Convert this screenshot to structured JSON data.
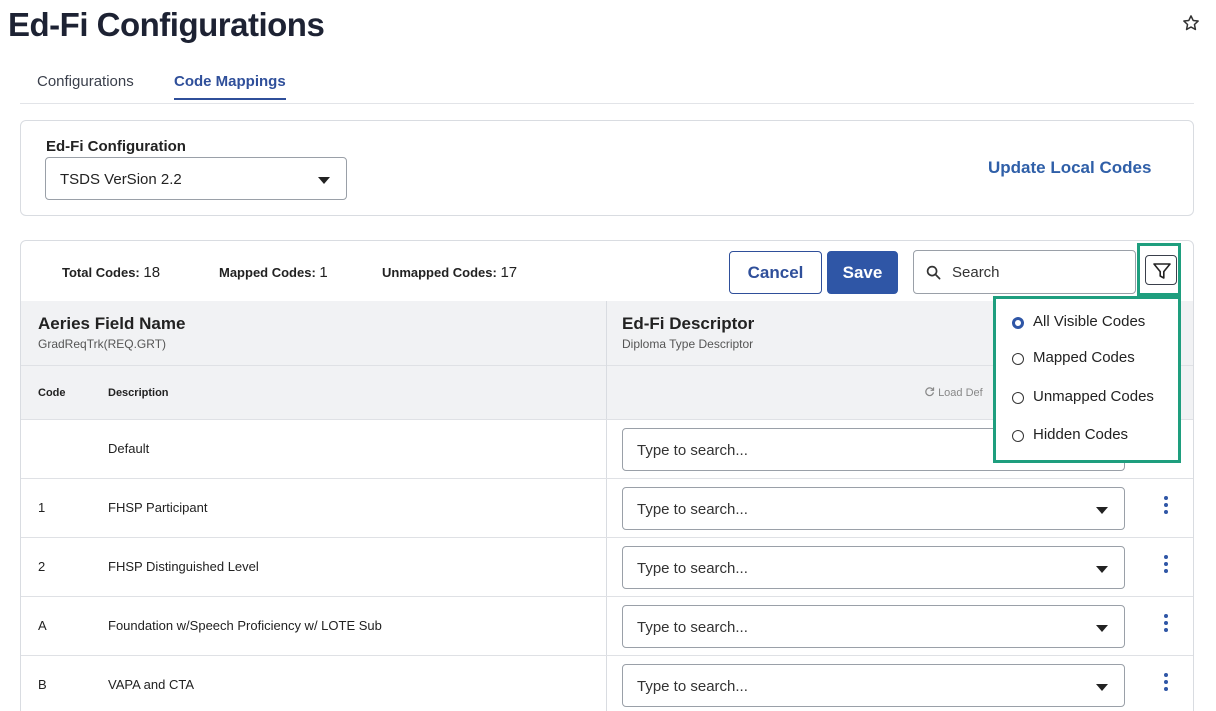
{
  "page": {
    "title": "Ed-Fi Configurations"
  },
  "tabs": [
    {
      "label": "Configurations"
    },
    {
      "label": "Code Mappings"
    }
  ],
  "config": {
    "label": "Ed-Fi Configuration",
    "selected_value": "TSDS VerSion 2.2",
    "update_link": "Update Local Codes"
  },
  "stats": {
    "total_label": "Total Codes:",
    "total_value": "18",
    "mapped_label": "Mapped Codes:",
    "mapped_value": "1",
    "unmapped_label": "Unmapped Codes:",
    "unmapped_value": "17"
  },
  "toolbar": {
    "cancel_label": "Cancel",
    "save_label": "Save",
    "search_placeholder": "Search"
  },
  "table": {
    "left_header": {
      "title": "Aeries Field Name",
      "subtitle": "GradReqTrk(REQ.GRT)"
    },
    "right_header": {
      "title": "Ed-Fi Descriptor",
      "subtitle": "Diploma Type Descriptor"
    },
    "col_code": "Code",
    "col_description": "Description",
    "load_defaults_label": "Load Def",
    "rows": [
      {
        "code": "",
        "description": "Default",
        "select_placeholder": "Type to search..."
      },
      {
        "code": "1",
        "description": "FHSP Participant",
        "select_placeholder": "Type to search..."
      },
      {
        "code": "2",
        "description": "FHSP Distinguished Level",
        "select_placeholder": "Type to search..."
      },
      {
        "code": "A",
        "description": "Foundation w/Speech Proficiency w/ LOTE Sub",
        "select_placeholder": "Type to search..."
      },
      {
        "code": "B",
        "description": "VAPA and CTA",
        "select_placeholder": "Type to search..."
      }
    ]
  },
  "filter_menu": {
    "options": [
      {
        "label": "All Visible Codes",
        "selected": true
      },
      {
        "label": "Mapped Codes",
        "selected": false
      },
      {
        "label": "Unmapped Codes",
        "selected": false
      },
      {
        "label": "Hidden Codes",
        "selected": false
      }
    ]
  },
  "colors": {
    "accent": "#2f56a6",
    "highlight": "#1e9e7e",
    "header_bg": "#f1f2f4"
  },
  "icons": [
    "star-icon",
    "search-icon",
    "filter-icon",
    "chevron-down-icon",
    "kebab-menu-icon",
    "refresh-icon"
  ]
}
